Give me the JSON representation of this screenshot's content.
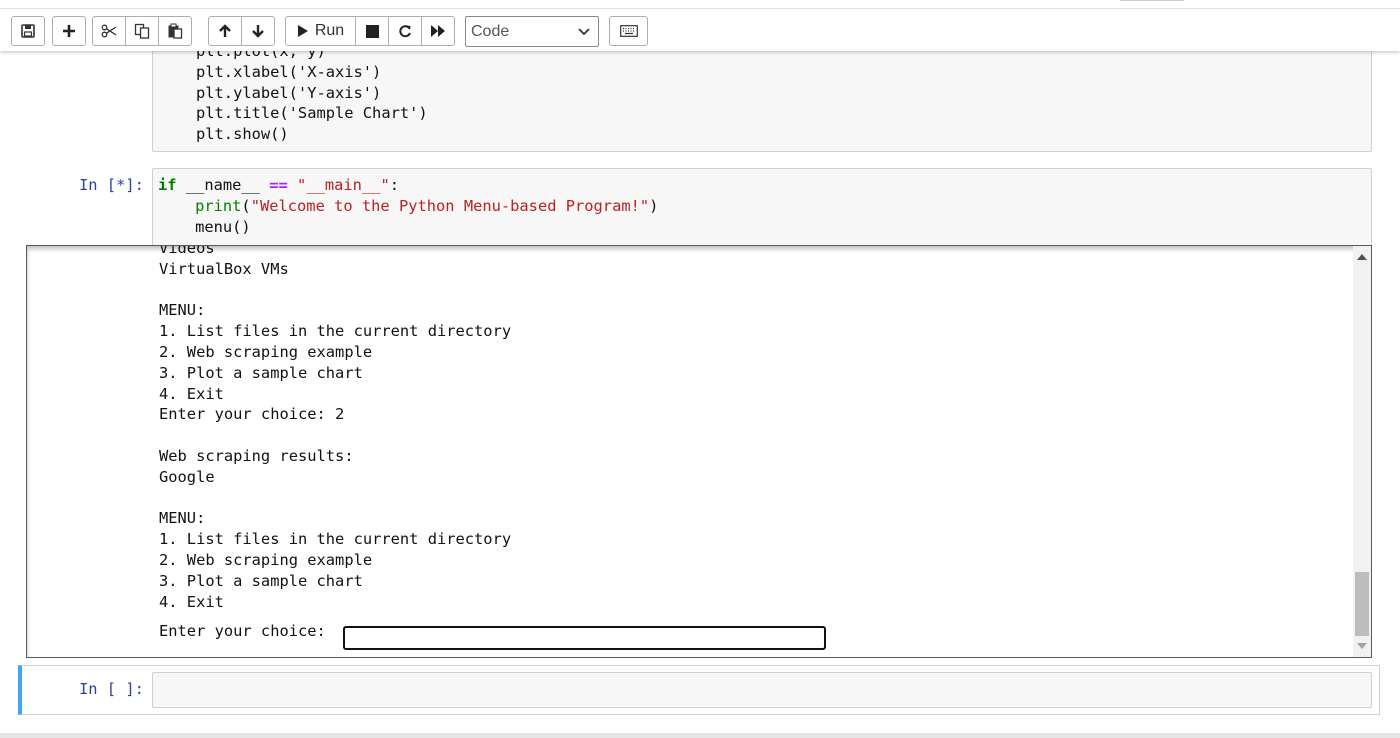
{
  "toolbar": {
    "buttons": [
      "save-icon",
      "plus-icon",
      "scissors-icon",
      "copy-icon",
      "paste-icon",
      "arrow-up-icon",
      "arrow-down-icon",
      "play-icon",
      "stop-icon",
      "restart-icon",
      "fast-forward-icon",
      "keyboard-icon"
    ],
    "run_label": "Run",
    "cell_type": "Code"
  },
  "cells": [
    {
      "prompt": "",
      "lines": [
        "plt.plot(x, y)",
        "plt.xlabel('X-axis')",
        "plt.ylabel('Y-axis')",
        "plt.title('Sample Chart')",
        "plt.show()"
      ]
    },
    {
      "prompt": "In [*]:",
      "line1_kw": "if",
      "line1_a": " __name__ ",
      "line1_op": "==",
      "line1_sp": " ",
      "line1_str": "\"__main__\"",
      "line1_end": ":",
      "line2_indent": "    ",
      "line2_fn": "print",
      "line2_open": "(",
      "line2_str": "\"Welcome to the Python Menu-based Program!\"",
      "line2_close": ")",
      "line3": "    menu()"
    },
    {
      "prompt": "In [ ]:"
    }
  ],
  "output": {
    "text": "Videos\nVirtualBox VMs\n\nMENU:\n1. List files in the current directory\n2. Web scraping example\n3. Plot a sample chart\n4. Exit\nEnter your choice: 2\n\nWeb scraping results:\nGoogle\n\nMENU:\n1. List files in the current directory\n2. Web scraping example\n3. Plot a sample chart\n4. Exit",
    "input_prompt": "Enter your choice: "
  },
  "colors": {
    "keyword": "#008000",
    "string": "#ba2121",
    "operator": "#aa22ff",
    "prompt": "#303f9f",
    "selected_cell_bar": "#42a5f5"
  }
}
